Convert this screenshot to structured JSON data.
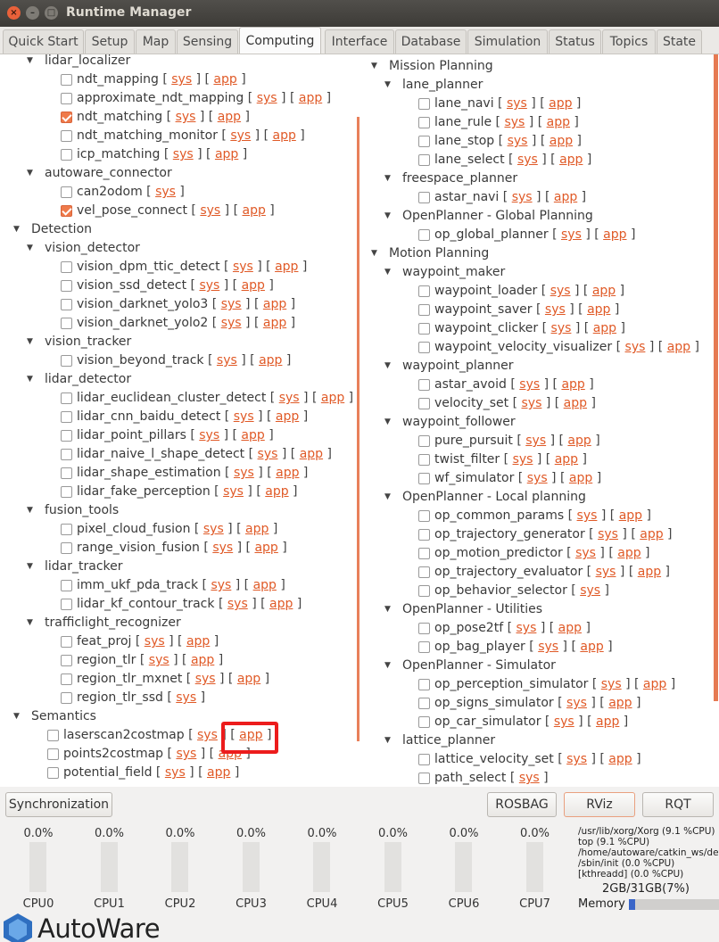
{
  "window": {
    "title": "Runtime Manager"
  },
  "tabs": [
    "Quick Start",
    "Setup",
    "Map",
    "Sensing",
    "Computing",
    "Interface",
    "Database",
    "Simulation",
    "Status",
    "Topics",
    "State"
  ],
  "active_tab": "Computing",
  "tree_left": [
    {
      "t": "node",
      "label": "lidar_localizer",
      "lvl": 1
    },
    {
      "t": "leaf",
      "label": "ndt_mapping",
      "chk": false,
      "links": [
        "sys",
        "app"
      ]
    },
    {
      "t": "leaf",
      "label": "approximate_ndt_mapping",
      "chk": false,
      "links": [
        "sys",
        "app"
      ]
    },
    {
      "t": "leaf",
      "label": "ndt_matching",
      "chk": true,
      "links": [
        "sys",
        "app"
      ]
    },
    {
      "t": "leaf",
      "label": "ndt_matching_monitor",
      "chk": false,
      "links": [
        "sys",
        "app"
      ]
    },
    {
      "t": "leaf",
      "label": "icp_matching",
      "chk": false,
      "links": [
        "sys",
        "app"
      ]
    },
    {
      "t": "node",
      "label": "autoware_connector",
      "lvl": 1
    },
    {
      "t": "leaf",
      "label": "can2odom",
      "chk": false,
      "links": [
        "sys"
      ]
    },
    {
      "t": "leaf",
      "label": "vel_pose_connect",
      "chk": true,
      "links": [
        "sys",
        "app"
      ]
    },
    {
      "t": "node",
      "label": "Detection",
      "lvl": 0
    },
    {
      "t": "node",
      "label": "vision_detector",
      "lvl": 1
    },
    {
      "t": "leaf",
      "label": "vision_dpm_ttic_detect",
      "chk": false,
      "links": [
        "sys",
        "app"
      ]
    },
    {
      "t": "leaf",
      "label": "vision_ssd_detect",
      "chk": false,
      "links": [
        "sys",
        "app"
      ]
    },
    {
      "t": "leaf",
      "label": "vision_darknet_yolo3",
      "chk": false,
      "links": [
        "sys",
        "app"
      ]
    },
    {
      "t": "leaf",
      "label": "vision_darknet_yolo2",
      "chk": false,
      "links": [
        "sys",
        "app"
      ]
    },
    {
      "t": "node",
      "label": "vision_tracker",
      "lvl": 1
    },
    {
      "t": "leaf",
      "label": "vision_beyond_track",
      "chk": false,
      "links": [
        "sys",
        "app"
      ]
    },
    {
      "t": "node",
      "label": "lidar_detector",
      "lvl": 1
    },
    {
      "t": "leaf",
      "label": "lidar_euclidean_cluster_detect",
      "chk": false,
      "links": [
        "sys",
        "app"
      ]
    },
    {
      "t": "leaf",
      "label": "lidar_cnn_baidu_detect",
      "chk": false,
      "links": [
        "sys",
        "app"
      ]
    },
    {
      "t": "leaf",
      "label": "lidar_point_pillars",
      "chk": false,
      "links": [
        "sys",
        "app"
      ]
    },
    {
      "t": "leaf",
      "label": "lidar_naive_l_shape_detect",
      "chk": false,
      "links": [
        "sys",
        "app"
      ]
    },
    {
      "t": "leaf",
      "label": "lidar_shape_estimation",
      "chk": false,
      "links": [
        "sys",
        "app"
      ]
    },
    {
      "t": "leaf",
      "label": "lidar_fake_perception",
      "chk": false,
      "links": [
        "sys",
        "app"
      ]
    },
    {
      "t": "node",
      "label": "fusion_tools",
      "lvl": 1
    },
    {
      "t": "leaf",
      "label": "pixel_cloud_fusion",
      "chk": false,
      "links": [
        "sys",
        "app"
      ]
    },
    {
      "t": "leaf",
      "label": "range_vision_fusion",
      "chk": false,
      "links": [
        "sys",
        "app"
      ]
    },
    {
      "t": "node",
      "label": "lidar_tracker",
      "lvl": 1
    },
    {
      "t": "leaf",
      "label": "imm_ukf_pda_track",
      "chk": false,
      "links": [
        "sys",
        "app"
      ]
    },
    {
      "t": "leaf",
      "label": "lidar_kf_contour_track",
      "chk": false,
      "links": [
        "sys",
        "app"
      ]
    },
    {
      "t": "node",
      "label": "trafficlight_recognizer",
      "lvl": 1
    },
    {
      "t": "leaf",
      "label": "feat_proj",
      "chk": false,
      "links": [
        "sys",
        "app"
      ]
    },
    {
      "t": "leaf",
      "label": "region_tlr",
      "chk": false,
      "links": [
        "sys",
        "app"
      ]
    },
    {
      "t": "leaf",
      "label": "region_tlr_mxnet",
      "chk": false,
      "links": [
        "sys",
        "app"
      ]
    },
    {
      "t": "leaf",
      "label": "region_tlr_ssd",
      "chk": false,
      "links": [
        "sys"
      ]
    },
    {
      "t": "node",
      "label": "Semantics",
      "lvl": 0
    },
    {
      "t": "leaf",
      "label": "laserscan2costmap",
      "chk": false,
      "links": [
        "sys",
        "app"
      ],
      "lvl": 1
    },
    {
      "t": "leaf",
      "label": "points2costmap",
      "chk": false,
      "links": [
        "sys",
        "app"
      ],
      "lvl": 1
    },
    {
      "t": "leaf",
      "label": "potential_field",
      "chk": false,
      "links": [
        "sys",
        "app"
      ],
      "lvl": 1
    }
  ],
  "tree_right": [
    {
      "t": "node",
      "label": "Mission Planning",
      "lvl": 0
    },
    {
      "t": "node",
      "label": "lane_planner",
      "lvl": 1
    },
    {
      "t": "leaf",
      "label": "lane_navi",
      "chk": false,
      "links": [
        "sys",
        "app"
      ]
    },
    {
      "t": "leaf",
      "label": "lane_rule",
      "chk": false,
      "links": [
        "sys",
        "app"
      ]
    },
    {
      "t": "leaf",
      "label": "lane_stop",
      "chk": false,
      "links": [
        "sys",
        "app"
      ]
    },
    {
      "t": "leaf",
      "label": "lane_select",
      "chk": false,
      "links": [
        "sys",
        "app"
      ]
    },
    {
      "t": "node",
      "label": "freespace_planner",
      "lvl": 1
    },
    {
      "t": "leaf",
      "label": "astar_navi",
      "chk": false,
      "links": [
        "sys",
        "app"
      ]
    },
    {
      "t": "node",
      "label": "OpenPlanner - Global Planning",
      "lvl": 1
    },
    {
      "t": "leaf",
      "label": "op_global_planner",
      "chk": false,
      "links": [
        "sys",
        "app"
      ]
    },
    {
      "t": "node",
      "label": "Motion Planning",
      "lvl": 0
    },
    {
      "t": "node",
      "label": "waypoint_maker",
      "lvl": 1
    },
    {
      "t": "leaf",
      "label": "waypoint_loader",
      "chk": false,
      "links": [
        "sys",
        "app"
      ]
    },
    {
      "t": "leaf",
      "label": "waypoint_saver",
      "chk": false,
      "links": [
        "sys",
        "app"
      ]
    },
    {
      "t": "leaf",
      "label": "waypoint_clicker",
      "chk": false,
      "links": [
        "sys",
        "app"
      ]
    },
    {
      "t": "leaf",
      "label": "waypoint_velocity_visualizer",
      "chk": false,
      "links": [
        "sys",
        "app"
      ]
    },
    {
      "t": "node",
      "label": "waypoint_planner",
      "lvl": 1
    },
    {
      "t": "leaf",
      "label": "astar_avoid",
      "chk": false,
      "links": [
        "sys",
        "app"
      ]
    },
    {
      "t": "leaf",
      "label": "velocity_set",
      "chk": false,
      "links": [
        "sys",
        "app"
      ]
    },
    {
      "t": "node",
      "label": "waypoint_follower",
      "lvl": 1
    },
    {
      "t": "leaf",
      "label": "pure_pursuit",
      "chk": false,
      "links": [
        "sys",
        "app"
      ]
    },
    {
      "t": "leaf",
      "label": "twist_filter",
      "chk": false,
      "links": [
        "sys",
        "app"
      ]
    },
    {
      "t": "leaf",
      "label": "wf_simulator",
      "chk": false,
      "links": [
        "sys",
        "app"
      ]
    },
    {
      "t": "node",
      "label": "OpenPlanner - Local planning",
      "lvl": 1
    },
    {
      "t": "leaf",
      "label": "op_common_params",
      "chk": false,
      "links": [
        "sys",
        "app"
      ]
    },
    {
      "t": "leaf",
      "label": "op_trajectory_generator",
      "chk": false,
      "links": [
        "sys",
        "app"
      ]
    },
    {
      "t": "leaf",
      "label": "op_motion_predictor",
      "chk": false,
      "links": [
        "sys",
        "app"
      ]
    },
    {
      "t": "leaf",
      "label": "op_trajectory_evaluator",
      "chk": false,
      "links": [
        "sys",
        "app"
      ]
    },
    {
      "t": "leaf",
      "label": "op_behavior_selector",
      "chk": false,
      "links": [
        "sys"
      ]
    },
    {
      "t": "node",
      "label": "OpenPlanner - Utilities",
      "lvl": 1
    },
    {
      "t": "leaf",
      "label": "op_pose2tf",
      "chk": false,
      "links": [
        "sys",
        "app"
      ]
    },
    {
      "t": "leaf",
      "label": "op_bag_player",
      "chk": false,
      "links": [
        "sys",
        "app"
      ]
    },
    {
      "t": "node",
      "label": "OpenPlanner - Simulator",
      "lvl": 1
    },
    {
      "t": "leaf",
      "label": "op_perception_simulator",
      "chk": false,
      "links": [
        "sys",
        "app"
      ]
    },
    {
      "t": "leaf",
      "label": "op_signs_simulator",
      "chk": false,
      "links": [
        "sys",
        "app"
      ]
    },
    {
      "t": "leaf",
      "label": "op_car_simulator",
      "chk": false,
      "links": [
        "sys",
        "app"
      ]
    },
    {
      "t": "node",
      "label": "lattice_planner",
      "lvl": 1
    },
    {
      "t": "leaf",
      "label": "lattice_velocity_set",
      "chk": false,
      "links": [
        "sys",
        "app"
      ]
    },
    {
      "t": "leaf",
      "label": "path_select",
      "chk": false,
      "links": [
        "sys"
      ]
    }
  ],
  "buttons": {
    "sync": "Synchronization",
    "rosbag": "ROSBAG",
    "rviz": "RViz",
    "rqt": "RQT"
  },
  "cpus": [
    {
      "name": "CPU0",
      "pct": "0.0%"
    },
    {
      "name": "CPU1",
      "pct": "0.0%"
    },
    {
      "name": "CPU2",
      "pct": "0.0%"
    },
    {
      "name": "CPU3",
      "pct": "0.0%"
    },
    {
      "name": "CPU4",
      "pct": "0.0%"
    },
    {
      "name": "CPU5",
      "pct": "0.0%"
    },
    {
      "name": "CPU6",
      "pct": "0.0%"
    },
    {
      "name": "CPU7",
      "pct": "0.0%"
    }
  ],
  "processes": [
    "/usr/lib/xorg/Xorg (9.1 %CPU)",
    "top (9.1 %CPU)",
    "/home/autoware/catkin_ws/devel",
    "/sbin/init (0.0 %CPU)",
    "[kthreadd] (0.0 %CPU)"
  ],
  "memory": {
    "usage": "2GB/31GB(7%)",
    "label": "Memory",
    "fraction": 0.07
  },
  "logo": {
    "text": "AutoWare"
  },
  "highlight_color": "#ec1c1c",
  "accent_color": "#e05a27"
}
